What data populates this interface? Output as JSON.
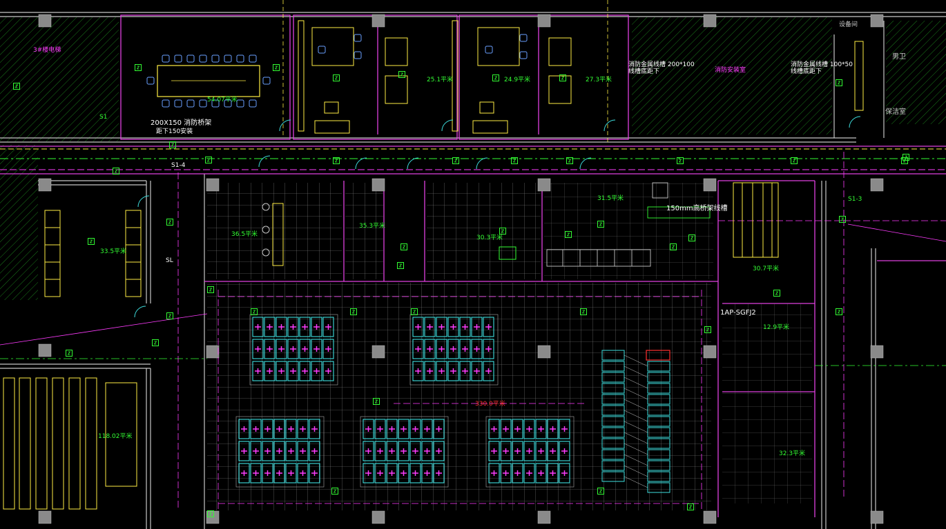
{
  "colors": {
    "background": "#000000",
    "wall": "#c0c0c0",
    "column": "#8a8a8a",
    "partition": "#e040e0",
    "magenta": "#ff3cff",
    "cyan": "#3ee0e0",
    "green": "#33ff33",
    "yellow": "#ffee44",
    "blue": "#6aa0ff",
    "red": "#ff3030",
    "white": "#ffffff",
    "hatch": "#1a8a1a"
  },
  "labels": {
    "meeting_area": "54.07平米",
    "cable_tray_1": "200X150 消防桥架",
    "cable_tray_1_note": "距下150安装",
    "office_1_area": "25.1平米",
    "office_2_area": "24.9平米",
    "office_3_area": "27.3平米",
    "cable_tray_2": "消防金属线槽 200*100",
    "cable_tray_2_note": "线槽底距下",
    "fire_room": "消防安装室",
    "cable_tray_3": "消防金属线槽 100*50",
    "cable_tray_3_note": "线槽底距下",
    "room_wc": "男卫",
    "room_cleaning": "保洁室",
    "room_equipment": "设备间",
    "shaft": "3#楼电梯",
    "area_31_5": "31.5平米",
    "area_33_5": "33.5平米",
    "area_36_5": "36.5平米",
    "area_30_3": "30.3平米",
    "area_35_3": "35.3平米",
    "area_30_7": "30.7平米",
    "area_12_9": "12.9平米",
    "area_32_3": "32.3平米",
    "area_118": "118.02平米",
    "area_330": "330.0平米",
    "trunk_label": "150mm高桥架线槽",
    "panel": "1AP-SGFJ2",
    "tag_s1": "S1",
    "tag_s3": "S1-3",
    "tag_s4": "S1-4",
    "tag_sl": "SL"
  }
}
